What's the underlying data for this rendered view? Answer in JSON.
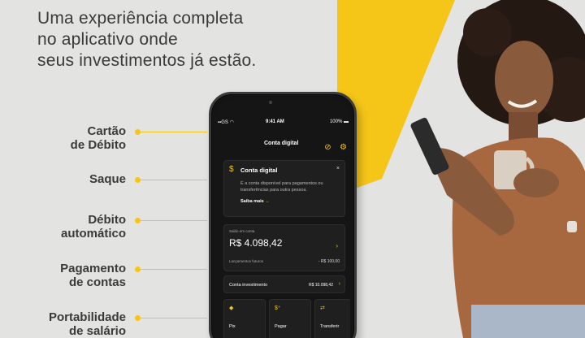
{
  "headline": {
    "line1": "Uma experiência completa",
    "line2": "no aplicativo onde",
    "line3": "seus investimentos já estão."
  },
  "features": [
    {
      "line1": "Cartão",
      "line2": "de Débito"
    },
    {
      "line1": "Saque",
      "line2": ""
    },
    {
      "line1": "Débito",
      "line2": "automático"
    },
    {
      "line1": "Pagamento",
      "line2": "de contas"
    },
    {
      "line1": "Portabilidade",
      "line2": "de salário"
    }
  ],
  "phone": {
    "status": {
      "carrier": "GS",
      "time": "9:41 AM",
      "battery": "100%"
    },
    "title": "Conta digital",
    "icons": [
      "eye-off-icon",
      "gear-icon"
    ],
    "promo": {
      "title": "Conta digital",
      "description": "É a conta disponível para pagamentos ou transferências para outra pessoa.",
      "more": "Saiba mais",
      "more_arrow": "→",
      "close": "×"
    },
    "balance": {
      "label": "Saldo em conta",
      "amount": "R$ 4.098,42",
      "future_label": "Lançamentos futuros",
      "future_value": "- R$ 100,00"
    },
    "investment": {
      "label": "Conta investimento",
      "value": "R$ 10.098,42"
    },
    "actions": [
      {
        "label": "Pix",
        "icon": "pix-icon"
      },
      {
        "label": "Pagar",
        "icon": "barcode-icon"
      },
      {
        "label": "Transferir",
        "icon": "transfer-icon"
      }
    ]
  },
  "colors": {
    "accent": "#f5c518",
    "background": "#e3e3e1",
    "phone": "#151515"
  }
}
